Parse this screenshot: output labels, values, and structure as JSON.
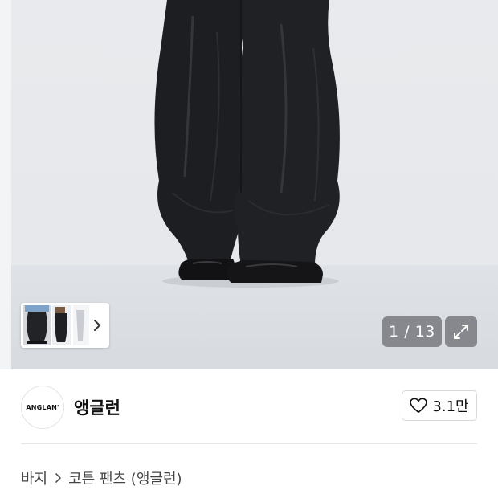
{
  "gallery": {
    "counter": "1 / 13",
    "thumbnails_more_icon": "chevron-right-icon",
    "expand_icon": "expand-icon"
  },
  "brand": {
    "logo_text": "ANGLAN'",
    "name": "앵글런",
    "like_icon": "heart-icon",
    "like_count": "3.1만"
  },
  "breadcrumb": {
    "category": "바지",
    "separator_icon": "chevron-right-icon",
    "product": "코튼 팬츠 (앵글런)"
  }
}
